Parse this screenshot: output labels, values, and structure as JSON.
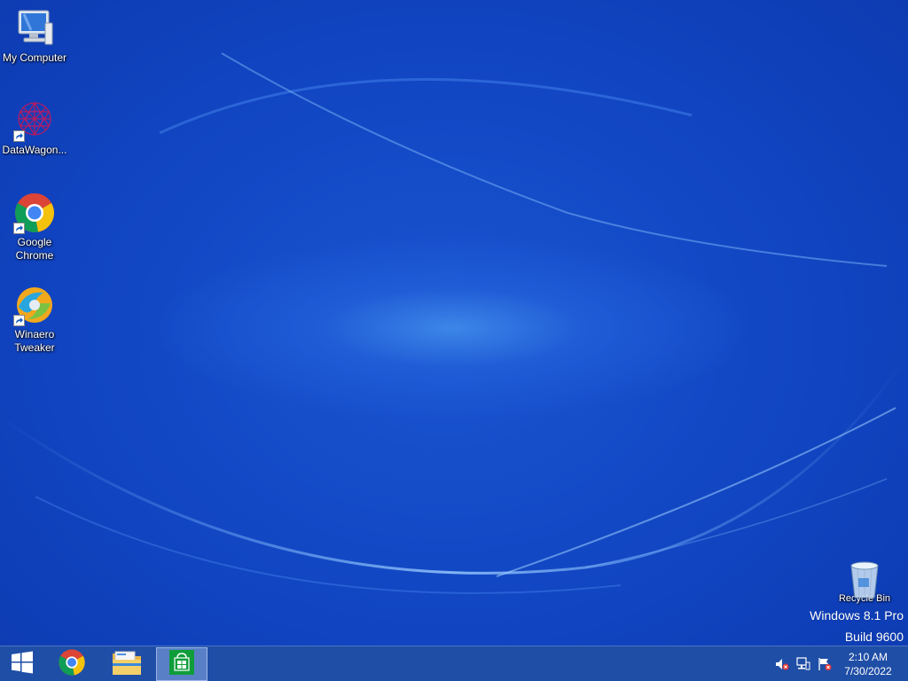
{
  "desktop": {
    "icons": [
      {
        "label": "My Computer",
        "icon": "computer-icon"
      },
      {
        "label": "DataWagon...",
        "icon": "datawagon-icon"
      },
      {
        "label": "Google Chrome",
        "icon": "chrome-icon"
      },
      {
        "label": "Winaero Tweaker",
        "icon": "winaero-icon"
      },
      {
        "label": "Recycle Bin",
        "icon": "recycle-bin-icon"
      }
    ],
    "watermark": {
      "line1": "Windows 8.1 Pro",
      "line2": "Build 9600"
    }
  },
  "taskbar": {
    "buttons": [
      {
        "name": "start",
        "icon": "windows-logo-icon"
      },
      {
        "name": "chrome",
        "icon": "chrome-icon"
      },
      {
        "name": "file-explorer",
        "icon": "folder-icon"
      },
      {
        "name": "store",
        "icon": "store-icon",
        "active": true
      }
    ],
    "tray": [
      {
        "icon": "speaker-muted-icon"
      },
      {
        "icon": "network-icon"
      },
      {
        "icon": "action-center-flag-icon"
      }
    ],
    "clock": {
      "time": "2:10 AM",
      "date": "7/30/2022"
    }
  },
  "colors": {
    "taskbar": "#1f4ea6",
    "desktop": "#1145c2"
  }
}
